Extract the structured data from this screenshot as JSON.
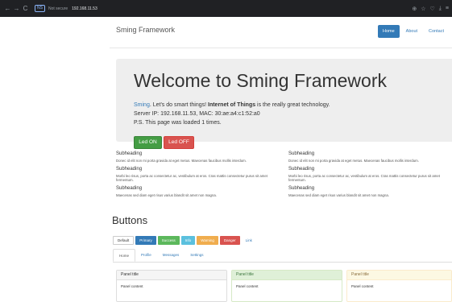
{
  "browser": {
    "back": "←",
    "forward": "→",
    "reload": "C",
    "security_badge": "NS",
    "security_text": "Not secure",
    "url": "192.168.11.53"
  },
  "navbar": {
    "brand": "Sming Framework",
    "links": [
      "Home",
      "About",
      "Contact"
    ]
  },
  "jumbotron": {
    "title": "Welcome to Sming Framework",
    "link_text": "Sming",
    "line1_a": ". Let's do smart things! ",
    "line1_bold": "Internet of Things",
    "line1_b": " is the really great technology.",
    "line2": "Server IP: 192.168.11.53, MAC: 30:ae:a4:c1:52:a0",
    "line3": "P.S. This page was loaded 1 times.",
    "btn_on": "Led ON",
    "btn_off": "Led OFF"
  },
  "columns": [
    [
      {
        "heading": "Subheading",
        "text": "Donec id elit non mi porta gravida at eget metus. Maecenas faucibus mollis interdum."
      },
      {
        "heading": "Subheading",
        "text": "Morbi leo risus, porta ac consectetur ac, vestibulum at eros. Cras mattis consectetur purus sit amet fermentum."
      },
      {
        "heading": "Subheading",
        "text": "Maecenas sed diam eget risus varius blandit sit amet non magna."
      }
    ],
    [
      {
        "heading": "Subheading",
        "text": "Donec id elit non mi porta gravida at eget metus. Maecenas faucibus mollis interdum."
      },
      {
        "heading": "Subheading",
        "text": "Morbi leo risus, porta ac consectetur ac, vestibulum at eros. Cras mattis consectetur purus sit amet fermentum."
      },
      {
        "heading": "Subheading",
        "text": "Maecenas sed diam eget risus varius blandit sit amet non magna."
      }
    ]
  ],
  "buttons_section": {
    "title": "Buttons",
    "buttons": [
      "Default",
      "Primary",
      "Success",
      "Info",
      "Warning",
      "Danger",
      "Link"
    ]
  },
  "tabs": [
    "Home",
    "Profile",
    "Messages",
    "Settings"
  ],
  "panels": [
    {
      "title": "Panel title",
      "content": "Panel content"
    },
    {
      "title": "Panel title",
      "content": "Panel content"
    },
    {
      "title": "Panel title",
      "content": "Panel content"
    }
  ],
  "colors": {
    "primary": "#337ab7",
    "success": "#5cb85c",
    "info": "#5bc0de",
    "warning": "#f0ad4e",
    "danger": "#d9534f"
  }
}
